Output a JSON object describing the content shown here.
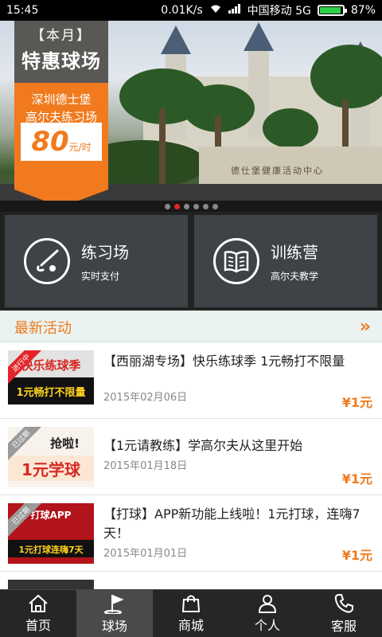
{
  "statusbar": {
    "time": "15:45",
    "speed": "0.01K/s",
    "carrier": "中国移动 5G",
    "battery": "87%"
  },
  "banner": {
    "badge_top": "【本月】",
    "badge_title": "特惠球场",
    "venue_line1": "深圳德士堡",
    "venue_line2": "高尔夫练习场",
    "price": "80",
    "price_unit": "元/时",
    "sign_text": "德仕堡健康活动中心",
    "pages": 6,
    "active_page": 2
  },
  "categories": [
    {
      "title": "练习场",
      "desc": "实时支付",
      "icon": "golf-swing-icon"
    },
    {
      "title": "训练营",
      "desc": "高尔夫教学",
      "icon": "book-icon"
    }
  ],
  "section": {
    "title": "最新活动",
    "more": "»"
  },
  "activities": [
    {
      "title": "【西丽湖专场】快乐练球季 1元畅打不限量",
      "date": "2015年02月06日",
      "price": "¥1元",
      "status": "进行中",
      "thumb_line1": "快乐练球季",
      "thumb_line2": "1元畅打不限量"
    },
    {
      "title": "【1元请教练】学高尔夫从这里开始",
      "date": "2015年01月18日",
      "price": "¥1元",
      "status": "已过期",
      "thumb_line1": "抢啦!",
      "thumb_line2": "1元学球"
    },
    {
      "title": "【打球】APP新功能上线啦！1元打球，连嗨7天！",
      "date": "2015年01月01日",
      "price": "¥1元",
      "status": "已过期",
      "thumb_line1": "打球APP",
      "thumb_line2": "1元打球连嗨7天"
    }
  ],
  "tabs": [
    {
      "label": "首页",
      "icon": "home-icon"
    },
    {
      "label": "球场",
      "icon": "golf-flag-icon"
    },
    {
      "label": "商城",
      "icon": "shopping-bag-icon"
    },
    {
      "label": "个人",
      "icon": "person-icon"
    },
    {
      "label": "客服",
      "icon": "phone-icon"
    }
  ],
  "active_tab": 1
}
